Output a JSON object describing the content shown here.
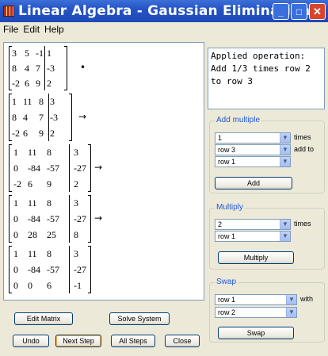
{
  "window": {
    "title": "Linear Algebra - Gaussian Elimination"
  },
  "menu": {
    "file": "File",
    "edit": "Edit",
    "help": "Help"
  },
  "matrices": [
    {
      "rows": [
        [
          "3",
          "5",
          "-1",
          "1"
        ],
        [
          "8",
          "4",
          "7",
          "-3"
        ],
        [
          "-2",
          "6",
          "9",
          "2"
        ]
      ],
      "arrow": "•"
    },
    {
      "rows": [
        [
          "1",
          "11",
          "8",
          "3"
        ],
        [
          "8",
          "4",
          "7",
          "-3"
        ],
        [
          "-2",
          "6",
          "9",
          "2"
        ]
      ],
      "arrow": "→"
    },
    {
      "rows": [
        [
          "1",
          "11",
          "8",
          "3"
        ],
        [
          "0",
          "-84",
          "-57",
          "-27"
        ],
        [
          "-2",
          "6",
          "9",
          "2"
        ]
      ],
      "arrow": "→"
    },
    {
      "rows": [
        [
          "1",
          "11",
          "8",
          "3"
        ],
        [
          "0",
          "-84",
          "-57",
          "-27"
        ],
        [
          "0",
          "28",
          "25",
          "8"
        ]
      ],
      "arrow": "→"
    },
    {
      "rows": [
        [
          "1",
          "11",
          "8",
          "3"
        ],
        [
          "0",
          "-84",
          "-57",
          "-27"
        ],
        [
          "0",
          "0",
          "6",
          "-1"
        ]
      ],
      "arrow": ""
    }
  ],
  "operation": {
    "text": "Applied operation:\nAdd 1/3 times row 2\nto row 3"
  },
  "add_multiple": {
    "title": "Add multiple",
    "factor": "1",
    "times_label": "times",
    "source_row": "row 3",
    "add_to_label": "add to",
    "target_row": "row 1",
    "button": "Add"
  },
  "multiply": {
    "title": "Multiply",
    "factor": "2",
    "times_label": "times",
    "row": "row 1",
    "button": "Multiply"
  },
  "swap": {
    "title": "Swap",
    "row_a": "row 1",
    "with_label": "with",
    "row_b": "row 2",
    "button": "Swap"
  },
  "buttons": {
    "edit_matrix": "Edit Matrix",
    "solve_system": "Solve System",
    "undo": "Undo",
    "next_step": "Next Step",
    "all_steps": "All Steps",
    "close": "Close"
  }
}
